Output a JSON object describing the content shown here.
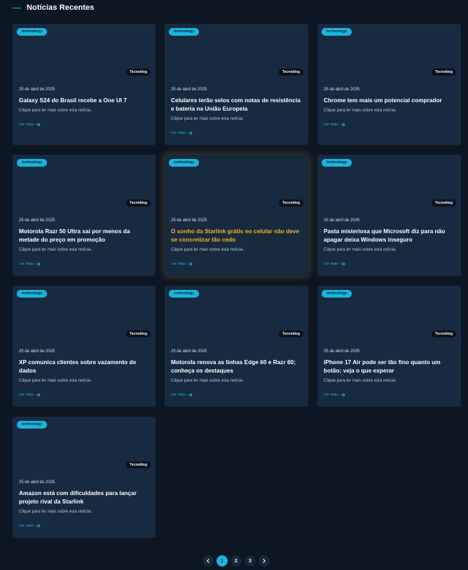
{
  "section": {
    "title": "Notícias Recentes"
  },
  "colors": {
    "accent": "#19b5dd",
    "highlight": "#f0b331",
    "card_bg": "#172a40",
    "page_bg": "#0d1623"
  },
  "cards": [
    {
      "category": "technology",
      "source": "Tecnoblog",
      "date": "25 de abril de 2025",
      "title": "Galaxy S24 do Brasil recebe a One UI 7",
      "description": "Clique para ler mais sobre esta notícia.",
      "link_label": "Ler mais"
    },
    {
      "category": "technology",
      "source": "Tecnoblog",
      "date": "25 de abril de 2025",
      "title": "Celulares terão selos com notas de resistência e bateria na União Europeia",
      "description": "Clique para ler mais sobre esta notícia.",
      "link_label": "Ler mais"
    },
    {
      "category": "technology",
      "source": "Tecnoblog",
      "date": "25 de abril de 2025",
      "title": "Chrome tem mais um potencial comprador",
      "description": "Clique para ler mais sobre esta notícia.",
      "link_label": "Ler mais"
    },
    {
      "category": "technology",
      "source": "Tecnoblog",
      "date": "25 de abril de 2025",
      "title": "Motorola Razr 50 Ultra sai por menos da metade do preço em promoção",
      "description": "Clique para ler mais sobre esta notícia.",
      "link_label": "Ler mais"
    },
    {
      "category": "technology",
      "source": "Tecnoblog",
      "date": "25 de abril de 2025",
      "title": "O sonho da Starlink grátis no celular não deve se concretizar tão cedo",
      "description": "Clique para ler mais sobre esta notícia.",
      "link_label": "Ler mais",
      "featured": true
    },
    {
      "category": "technology",
      "source": "Tecnoblog",
      "date": "25 de abril de 2025",
      "title": "Pasta misteriosa que Microsoft diz para não apagar deixa Windows inseguro",
      "description": "Clique para ler mais sobre esta notícia.",
      "link_label": "Ler mais"
    },
    {
      "category": "technology",
      "source": "Tecnoblog",
      "date": "25 de abril de 2025",
      "title": "XP comunica clientes sobre vazamento de dados",
      "description": "Clique para ler mais sobre esta notícia.",
      "link_label": "Ler mais"
    },
    {
      "category": "technology",
      "source": "Tecnoblog",
      "date": "25 de abril de 2025",
      "title": "Motorola renova as linhas Edge 60 e Razr 60; conheça os destaques",
      "description": "Clique para ler mais sobre esta notícia.",
      "link_label": "Ler mais"
    },
    {
      "category": "technology",
      "source": "Tecnoblog",
      "date": "25 de abril de 2025",
      "title": "iPhone 17 Air pode ser tão fino quanto um botão; veja o que esperar",
      "description": "Clique para ler mais sobre esta notícia.",
      "link_label": "Ler mais"
    },
    {
      "category": "technology",
      "source": "Tecnoblog",
      "date": "25 de abril de 2025",
      "title": "Amazon está com dificuldades para lançar projeto rival da Starlink",
      "description": "Clique para ler mais sobre esta notícia.",
      "link_label": "Ler mais"
    }
  ],
  "pagination": {
    "prev_icon": "chevron-left-icon",
    "next_icon": "chevron-right-icon",
    "pages": [
      "1",
      "2",
      "3"
    ],
    "current": "1"
  }
}
